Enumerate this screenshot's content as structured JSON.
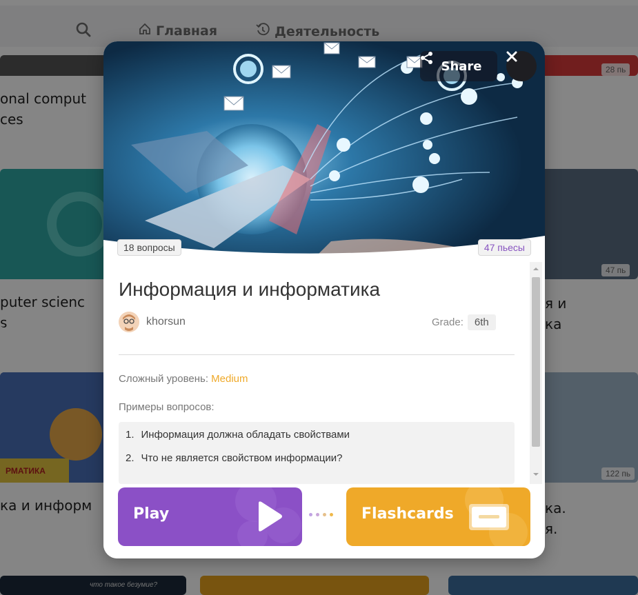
{
  "colors": {
    "primary_purple": "#8b50c6",
    "accent_orange": "#efa929",
    "plays_text": "#8854c0"
  },
  "background": {
    "nav": {
      "search_icon": "search-icon",
      "home_label": "Главная",
      "activity_label": "Деятельность"
    },
    "cards": [
      {
        "text": "onal comput\nces",
        "plays": "28 пь"
      },
      {
        "text": "puter scienc\ns",
        "plays": "47 пь"
      },
      {
        "text": "ка и информ",
        "plays": "122 пь"
      },
      {
        "text": "я и\nка"
      },
      {
        "text": "ка.\nя."
      }
    ],
    "thumbnail_texts": {
      "small_banner": "что такое безумие?",
      "matika": "РМАТИКА"
    }
  },
  "modal": {
    "share_label": "Share",
    "share_icon": "share-icon",
    "close_icon": "close-icon",
    "questions_count": "18 вопросы",
    "plays_count": "47 пьесы",
    "title": "Информация и информатика",
    "author": "khorsun",
    "grade_label": "Grade:",
    "grade_value": "6th",
    "difficulty_label": "Сложный уровень:",
    "difficulty_value": "Medium",
    "examples_label": "Примеры вопросов:",
    "questions": [
      {
        "num": "1.",
        "text": "Информация должна обладать свойствами"
      },
      {
        "num": "2.",
        "text": "Что не является свойством информации?"
      }
    ],
    "play_label": "Play",
    "flashcards_label": "Flashcards"
  }
}
